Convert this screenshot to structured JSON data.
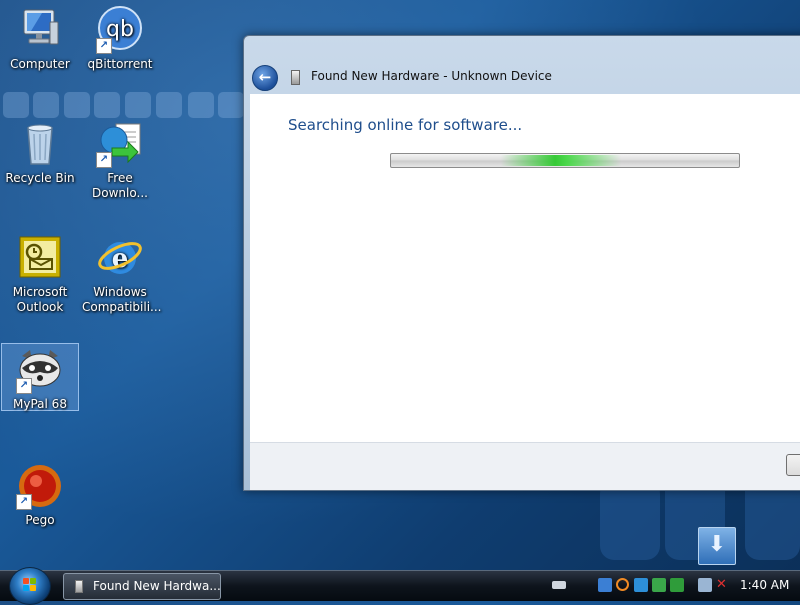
{
  "desktop": {
    "icons": [
      {
        "label": "Computer"
      },
      {
        "label": "qBittorrent"
      },
      {
        "label": "Recycle Bin"
      },
      {
        "label": "Free Downlo..."
      },
      {
        "label": "Microsoft Outlook"
      },
      {
        "label": "Windows Compatibili..."
      },
      {
        "label": "MyPal 68"
      },
      {
        "label": "Pego"
      }
    ]
  },
  "window": {
    "title": "Found New Hardware - Unknown Device",
    "status_text": "Searching online for software...",
    "progress_state": "indeterminate"
  },
  "taskbar": {
    "task_label": "Found New Hardwa...",
    "clock": "1:40 AM"
  },
  "colors": {
    "desktop_blue": "#1a5a9a",
    "heading_blue": "#1f4e8c",
    "progress_green": "#2dc82d"
  }
}
